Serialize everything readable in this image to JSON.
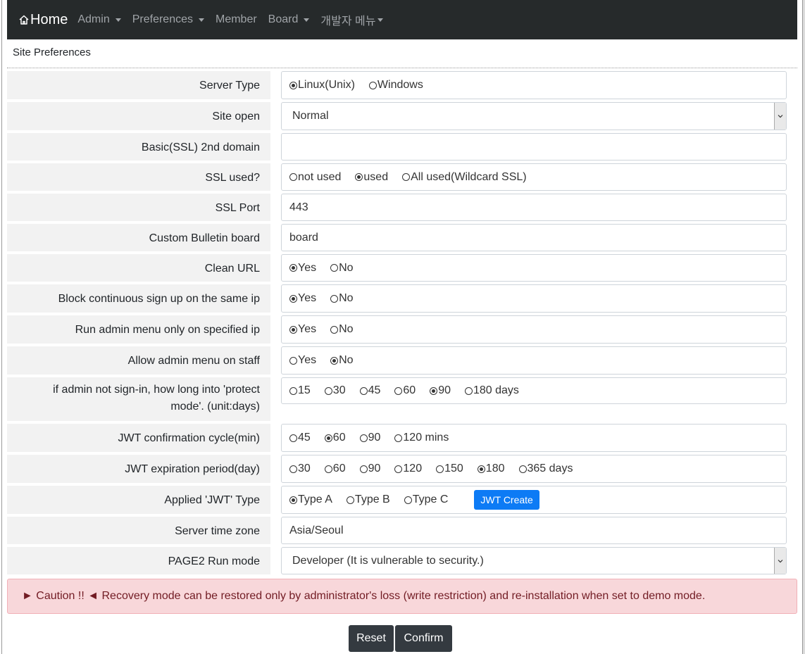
{
  "navbar": {
    "brand": "Home",
    "items": [
      {
        "label": "Admin",
        "dropdown": true
      },
      {
        "label": "Preferences",
        "dropdown": true
      },
      {
        "label": "Member",
        "dropdown": false
      },
      {
        "label": "Board",
        "dropdown": true
      },
      {
        "label": "개발자 메뉴",
        "dropdown": true
      }
    ]
  },
  "page_title": "Site Preferences",
  "form": {
    "server_type": {
      "label": "Server Type",
      "options": [
        "Linux(Unix)",
        "Windows"
      ],
      "selected": "Linux(Unix)"
    },
    "site_open": {
      "label": "Site open",
      "value": "Normal"
    },
    "ssl_domain": {
      "label": "Basic(SSL) 2nd domain",
      "value": ""
    },
    "ssl_used": {
      "label": "SSL used?",
      "options": [
        "not used",
        "used",
        "All used(Wildcard SSL)"
      ],
      "selected": "used"
    },
    "ssl_port": {
      "label": "SSL Port",
      "value": "443"
    },
    "custom_board": {
      "label": "Custom Bulletin board",
      "value": "board"
    },
    "clean_url": {
      "label": "Clean URL",
      "options": [
        "Yes",
        "No"
      ],
      "selected": "Yes"
    },
    "block_signup": {
      "label": "Block continuous sign up on the same ip",
      "options": [
        "Yes",
        "No"
      ],
      "selected": "Yes"
    },
    "admin_ip": {
      "label": "Run admin menu only on specified ip",
      "options": [
        "Yes",
        "No"
      ],
      "selected": "Yes"
    },
    "admin_staff": {
      "label": "Allow admin menu on staff",
      "options": [
        "Yes",
        "No"
      ],
      "selected": "No"
    },
    "protect_mode": {
      "label_line1": "if admin not sign-in, how long into 'protect",
      "label_line2": "mode'. (unit:days)",
      "options": [
        "15",
        "30",
        "45",
        "60",
        "90",
        "180 days"
      ],
      "selected": "90"
    },
    "jwt_cycle": {
      "label": "JWT confirmation cycle(min)",
      "options": [
        "45",
        "60",
        "90",
        "120 mins"
      ],
      "selected": "60"
    },
    "jwt_expire": {
      "label": "JWT expiration period(day)",
      "options": [
        "30",
        "60",
        "90",
        "120",
        "150",
        "180",
        "365 days"
      ],
      "selected": "180"
    },
    "jwt_type": {
      "label": "Applied 'JWT' Type",
      "options": [
        "Type A",
        "Type B",
        "Type C"
      ],
      "selected": "Type A",
      "button": "JWT Create"
    },
    "timezone": {
      "label": "Server time zone",
      "value": "Asia/Seoul"
    },
    "run_mode": {
      "label": "PAGE2 Run mode",
      "value": "Developer (It is vulnerable to security.)"
    }
  },
  "caution": "► Caution !! ◄ Recovery mode can be restored only by administrator's loss (write restriction) and re-installation when set to demo mode.",
  "buttons": {
    "reset": "Reset",
    "confirm": "Confirm"
  }
}
